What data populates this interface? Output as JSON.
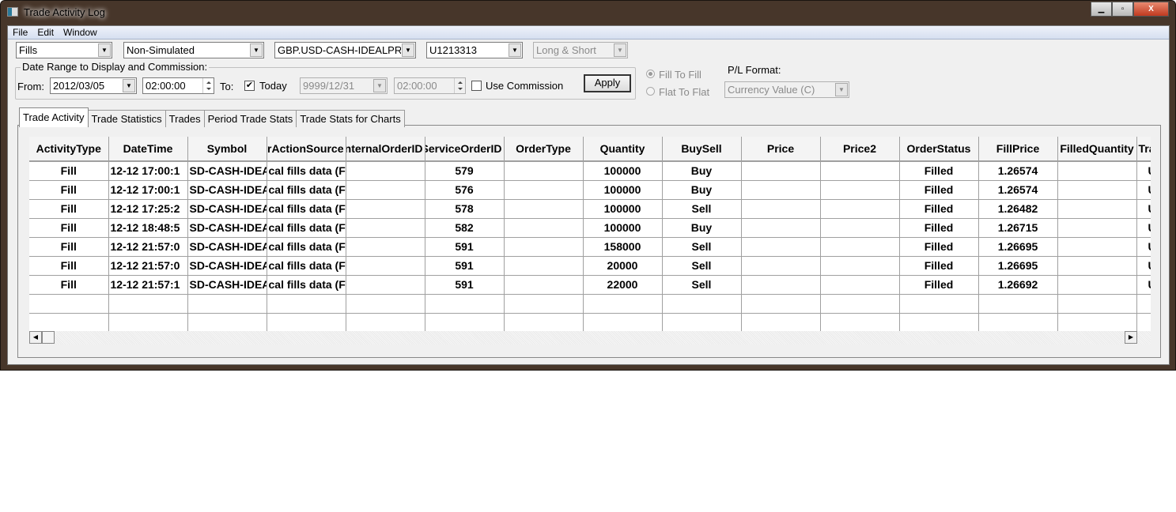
{
  "window": {
    "title": "Trade Activity Log",
    "minimize": "▁",
    "maximize": "▫",
    "close": "X"
  },
  "menu": [
    "File",
    "Edit",
    "Window"
  ],
  "filters": {
    "type": "Fills",
    "simulation": "Non-Simulated",
    "symbol": "GBP.USD-CASH-IDEALPRO",
    "account": "U1213313",
    "side": "Long & Short"
  },
  "date_range": {
    "label": "Date Range to Display and Commission:",
    "from_label": "From:",
    "from_date": "2012/03/05",
    "from_time": "02:00:00",
    "to_label": "To:",
    "today_label": "Today",
    "today_checked": true,
    "to_date": "9999/12/31",
    "to_time": "02:00:00",
    "use_commission_label": "Use Commission",
    "use_commission_checked": false,
    "apply_label": "Apply"
  },
  "pl": {
    "fill_to_fill": "Fill To Fill",
    "flat_to_flat": "Flat To Flat",
    "format_label": "P/L Format:",
    "format_value": "Currency Value (C)"
  },
  "tabs": [
    "Trade Activity",
    "Trade Statistics",
    "Trades",
    "Period Trade Stats",
    "Trade Stats for Charts"
  ],
  "table": {
    "columns": [
      "ActivityType",
      "DateTime",
      "Symbol",
      "OrderActionSource",
      "InternalOrderID",
      "ServiceOrderID",
      "OrderType",
      "Quantity",
      "BuySell",
      "Price",
      "Price2",
      "OrderStatus",
      "FillPrice",
      "FilledQuantity",
      "Tra"
    ],
    "rows": [
      [
        "Fill",
        "12-12 17:00:1",
        "SD-CASH-IDEA",
        "cal fills data (F",
        "",
        "579",
        "",
        "100000",
        "Buy",
        "",
        "",
        "Filled",
        "1.26574",
        "",
        "U"
      ],
      [
        "Fill",
        "12-12 17:00:1",
        "SD-CASH-IDEA",
        "cal fills data (F",
        "",
        "576",
        "",
        "100000",
        "Buy",
        "",
        "",
        "Filled",
        "1.26574",
        "",
        "U"
      ],
      [
        "Fill",
        "12-12 17:25:2",
        "SD-CASH-IDEA",
        "cal fills data (F",
        "",
        "578",
        "",
        "100000",
        "Sell",
        "",
        "",
        "Filled",
        "1.26482",
        "",
        "U"
      ],
      [
        "Fill",
        "12-12 18:48:5",
        "SD-CASH-IDEA",
        "cal fills data (F",
        "",
        "582",
        "",
        "100000",
        "Buy",
        "",
        "",
        "Filled",
        "1.26715",
        "",
        "U"
      ],
      [
        "Fill",
        "12-12 21:57:0",
        "SD-CASH-IDEA",
        "cal fills data (F",
        "",
        "591",
        "",
        "158000",
        "Sell",
        "",
        "",
        "Filled",
        "1.26695",
        "",
        "U"
      ],
      [
        "Fill",
        "12-12 21:57:0",
        "SD-CASH-IDEA",
        "cal fills data (F",
        "",
        "591",
        "",
        "20000",
        "Sell",
        "",
        "",
        "Filled",
        "1.26695",
        "",
        "U"
      ],
      [
        "Fill",
        "12-12 21:57:1",
        "SD-CASH-IDEA",
        "cal fills data (F",
        "",
        "591",
        "",
        "22000",
        "Sell",
        "",
        "",
        "Filled",
        "1.26692",
        "",
        "U"
      ]
    ],
    "empty_rows": 2
  }
}
